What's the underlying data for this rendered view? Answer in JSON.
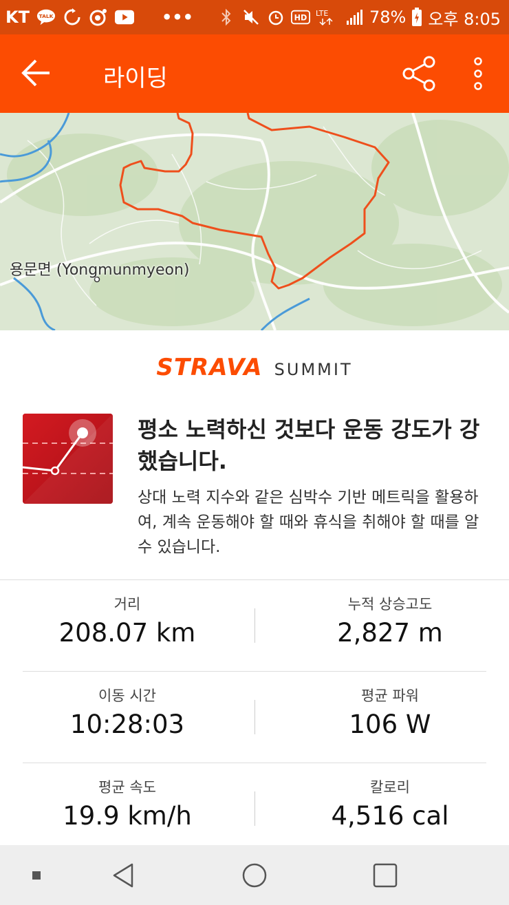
{
  "status_bar": {
    "carrier": "KT",
    "talk_badge": "TALK",
    "hd_badge": "HD",
    "lte_label": "LTE",
    "battery": "78%",
    "time": "오후 8:05"
  },
  "app_bar": {
    "title": "라이딩"
  },
  "map": {
    "place_label": "용문면 (Yongmunmyeon)",
    "route_color": "#ee4f1c"
  },
  "subscription": {
    "brand": "STRAVA",
    "tier": "SUMMIT"
  },
  "promo": {
    "title": "평소 노력하신 것보다 운동 강도가 강했습니다.",
    "description": "상대 노력 지수와 같은 심박수 기반 메트릭을 활용하여, 계속 운동해야 할 때와 휴식을 취해야 할 때를 알 수 있습니다."
  },
  "stats": [
    {
      "label": "거리",
      "value": "208.07 km"
    },
    {
      "label": "누적 상승고도",
      "value": "2,827 m"
    },
    {
      "label": "이동 시간",
      "value": "10:28:03"
    },
    {
      "label": "평균 파워",
      "value": "106 W"
    },
    {
      "label": "평균 속도",
      "value": "19.9 km/h"
    },
    {
      "label": "칼로리",
      "value": "4,516 cal"
    }
  ],
  "colors": {
    "status_bar": "#d84a0a",
    "app_bar": "#fc4c02",
    "brand": "#fc4c02",
    "promo_icon_bg": "#c8151b"
  }
}
